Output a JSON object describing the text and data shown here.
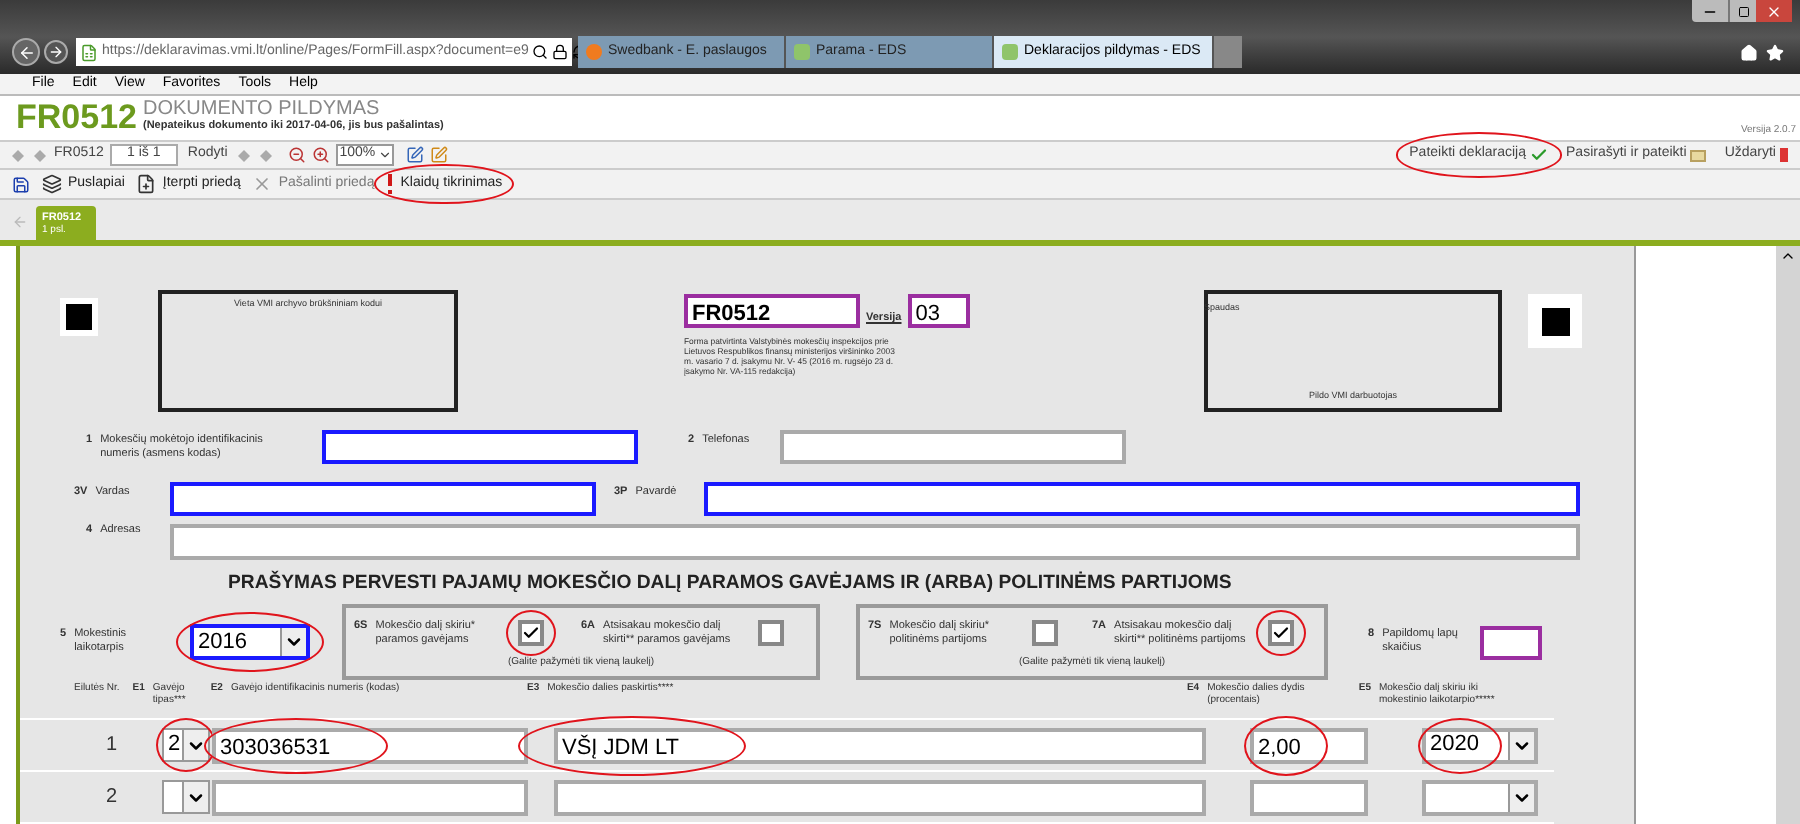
{
  "browser": {
    "url": "https://deklaravimas.vmi.lt/online/Pages/FormFill.aspx?document=e9",
    "tabs": [
      {
        "title": "Swedbank - E. paslaugos",
        "selected": false
      },
      {
        "title": "Parama - EDS",
        "selected": false
      },
      {
        "title": "Deklaracijos pildymas - EDS",
        "selected": true
      }
    ]
  },
  "menu": [
    "File",
    "Edit",
    "View",
    "Favorites",
    "Tools",
    "Help"
  ],
  "header": {
    "code": "FR0512",
    "title": "DOKUMENTO PILDYMAS",
    "notice": "(Nepateikus dokumento iki 2017-04-06, jis bus pašalintas)",
    "version": "Versija 2.0.7"
  },
  "toolbar": {
    "form": "FR0512",
    "page": "1 iš 1",
    "show": "Rodyti",
    "zoom": "100%",
    "actions": [
      {
        "label": "Pateikti deklaraciją",
        "circled": true
      },
      {
        "label": "Pasirašyti ir pateikti",
        "circled": false
      },
      {
        "label": "Uždaryti",
        "circled": false
      }
    ]
  },
  "commands": [
    {
      "kind": "pages",
      "label": "Puslapiai",
      "disabled": false,
      "circled": false
    },
    {
      "kind": "insert",
      "label": "Įterpti priedą",
      "disabled": false,
      "circled": false
    },
    {
      "kind": "remove",
      "label": "Pašalinti priedą",
      "disabled": true,
      "circled": false
    },
    {
      "kind": "check",
      "label": "Klaidų tikrinimas",
      "disabled": false,
      "circled": true
    }
  ],
  "doc_tabs": [
    {
      "title": "FR0512",
      "subtitle": "1 psl.",
      "selected": true
    }
  ],
  "form": {
    "archive_label": "Vieta VMI archyvo brūkšniniam kodui",
    "form_code": "FR0512",
    "version_label": "Versija",
    "version": "03",
    "approval": "Forma patvirtinta Valstybinės mokesčių inspekcijos prie Lietuvos Respublikos finansų ministerijos viršininko 2003 m. vasario 7 d. įsakymu Nr. V- 45 (2016 m. rugsėjo 23 d. įsakymo Nr. VA-115 redakcija)",
    "stamp_label": "Spaudas",
    "stamp_note": "Pildo VMI darbuotojas",
    "fields": [
      {
        "number": "1",
        "label": "Mokesčių mokėtojo identifikacinis numeris (asmens kodas)",
        "required": true
      },
      {
        "number": "2",
        "label": "Telefonas",
        "required": false
      },
      {
        "number": "3V",
        "label": "Vardas",
        "required": true
      },
      {
        "number": "3P",
        "label": "Pavardė",
        "required": true
      },
      {
        "number": "4",
        "label": "Adresas",
        "required": false
      }
    ],
    "heading": "PRAŠYMAS PERVESTI PAJAMŲ MOKESČIO DALĮ PARAMOS GAVĖJAMS IR (ARBA) POLITINĖMS PARTIJOMS",
    "period": {
      "number": "5",
      "label": "Mokestinis laikotarpis",
      "value": "2016",
      "circled": true
    },
    "groups": [
      {
        "note": "(Galite pažymėti tik vieną laukelį)",
        "options": [
          {
            "number": "6S",
            "label": "Mokesčio dalį skiriu* paramos gavėjams",
            "checked": true,
            "circled": true
          },
          {
            "number": "6A",
            "label": "Atsisakau mokesčio dalį skirti** paramos gavėjams",
            "checked": false,
            "circled": false
          }
        ]
      },
      {
        "note": "(Galite pažymėti tik vieną laukelį)",
        "options": [
          {
            "number": "7S",
            "label": "Mokesčio dalį skiriu* politinėms partijoms",
            "checked": false,
            "circled": false
          },
          {
            "number": "7A",
            "label": "Atsisakau mokesčio dalį skirti** politinėms partijoms",
            "checked": true,
            "circled": true
          }
        ]
      }
    ],
    "extra_pages": {
      "number": "8",
      "label": "Papildomų lapų skaičius"
    },
    "columns": [
      {
        "label": "Eilutės Nr."
      },
      {
        "code": "E1",
        "label": "Gavėjo tipas***"
      },
      {
        "code": "E2",
        "label": "Gavėjo identifikacinis numeris (kodas)"
      },
      {
        "code": "E3",
        "label": "Mokesčio dalies paskirtis****"
      },
      {
        "code": "E4",
        "label": "Mokesčio dalies dydis (procentais)"
      },
      {
        "code": "E5",
        "label": "Mokesčio dalį skiriu iki mokestinio laikotarpio*****"
      }
    ],
    "rows": [
      {
        "number": "1",
        "type": "2",
        "recipient_id": "303036531",
        "purpose": "VŠĮ JDM LT",
        "percent": "2,00",
        "until": "2020",
        "circled": true
      },
      {
        "number": "2",
        "circled": false
      }
    ]
  }
}
